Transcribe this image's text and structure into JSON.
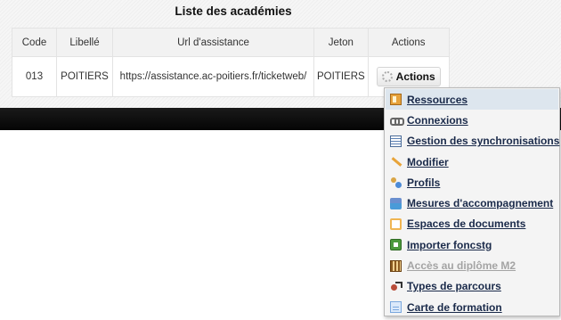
{
  "page": {
    "title": "Liste des académies"
  },
  "table": {
    "headers": {
      "code": "Code",
      "libelle": "Libellé",
      "url": "Url d'assistance",
      "jeton": "Jeton",
      "actions": "Actions"
    },
    "rows": [
      {
        "code": "013",
        "libelle": "POITIERS",
        "url": "https://assistance.ac-poitiers.fr/ticketweb/",
        "jeton": "POITIERS",
        "actions_label": "Actions"
      }
    ]
  },
  "actions_menu": {
    "items": [
      {
        "label": "Ressources",
        "icon": "book-icon",
        "state": "highlighted"
      },
      {
        "label": "Connexions",
        "icon": "chain-link-icon",
        "state": "enabled"
      },
      {
        "label": "Gestion des synchronisations",
        "icon": "table-icon",
        "state": "enabled"
      },
      {
        "label": "Modifier",
        "icon": "pencil-icon",
        "state": "enabled"
      },
      {
        "label": "Profils",
        "icon": "users-icon",
        "state": "enabled"
      },
      {
        "label": "Mesures d'accompagnement",
        "icon": "monitor-icon",
        "state": "enabled"
      },
      {
        "label": "Espaces de documents",
        "icon": "folder-icon",
        "state": "enabled"
      },
      {
        "label": "Importer foncstg",
        "icon": "spreadsheet-import-icon",
        "state": "enabled"
      },
      {
        "label": "Accès au diplôme M2",
        "icon": "ledger-icon",
        "state": "disabled"
      },
      {
        "label": "Types de parcours",
        "icon": "route-icon",
        "state": "enabled"
      },
      {
        "label": "Carte de formation",
        "icon": "document-icon",
        "state": "enabled"
      }
    ]
  },
  "colors": {
    "header_bar": "#0b0b0b",
    "menu_background": "#f4f4f4",
    "menu_highlight": "#dde6ee",
    "menu_link": "#1a2a4a",
    "menu_disabled": "#a4a4a4"
  }
}
